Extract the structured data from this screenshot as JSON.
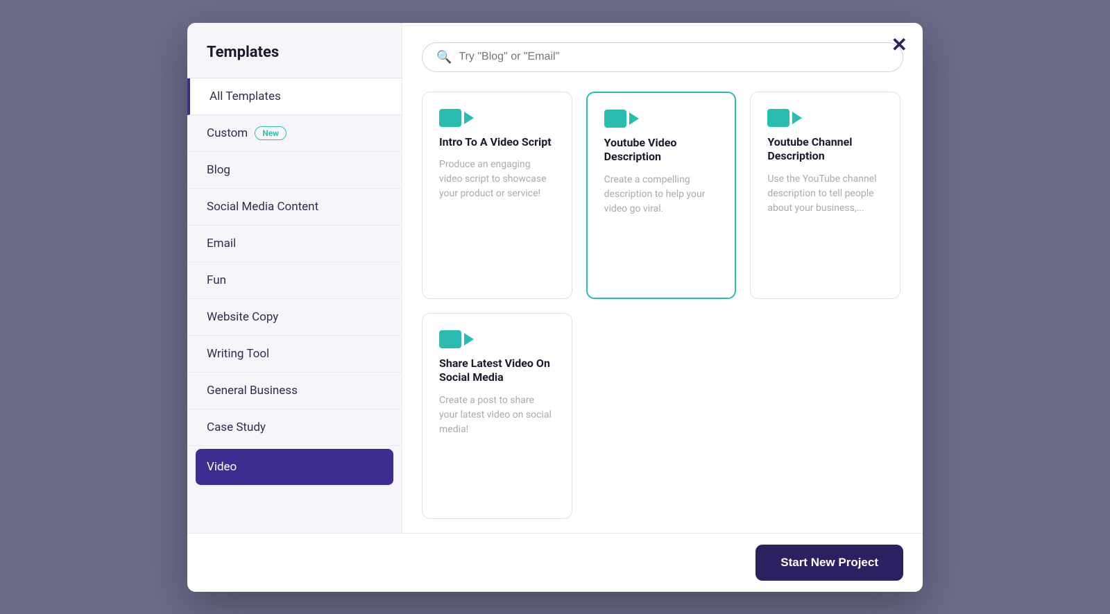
{
  "sidebar": {
    "title": "Templates",
    "items": [
      {
        "id": "all-templates",
        "label": "All Templates",
        "badge": null,
        "active": false,
        "all": true
      },
      {
        "id": "custom",
        "label": "Custom",
        "badge": "New",
        "active": false
      },
      {
        "id": "blog",
        "label": "Blog",
        "badge": null,
        "active": false
      },
      {
        "id": "social-media",
        "label": "Social Media Content",
        "badge": null,
        "active": false
      },
      {
        "id": "email",
        "label": "Email",
        "badge": null,
        "active": false
      },
      {
        "id": "fun",
        "label": "Fun",
        "badge": null,
        "active": false
      },
      {
        "id": "website-copy",
        "label": "Website Copy",
        "badge": null,
        "active": false
      },
      {
        "id": "writing-tool",
        "label": "Writing Tool",
        "badge": null,
        "active": false
      },
      {
        "id": "general-business",
        "label": "General Business",
        "badge": null,
        "active": false
      },
      {
        "id": "case-study",
        "label": "Case Study",
        "badge": null,
        "active": false
      },
      {
        "id": "video",
        "label": "Video",
        "badge": null,
        "active": true
      }
    ]
  },
  "search": {
    "placeholder": "Try \"Blog\" or \"Email\""
  },
  "cards": [
    {
      "id": "intro-video-script",
      "title": "Intro To A Video Script",
      "description": "Produce an engaging video script to showcase your product or service!",
      "selected": false
    },
    {
      "id": "youtube-video-description",
      "title": "Youtube Video Description",
      "description": "Create a compelling description to help your video go viral.",
      "selected": true
    },
    {
      "id": "youtube-channel-description",
      "title": "Youtube Channel Description",
      "description": "Use the YouTube channel description to tell people about your business,...",
      "selected": false
    },
    {
      "id": "share-latest-video",
      "title": "Share Latest Video On Social Media",
      "description": "Create a post to share your latest video on social media!",
      "selected": false
    }
  ],
  "footer": {
    "button_label": "Start New Project"
  },
  "close": "✕"
}
